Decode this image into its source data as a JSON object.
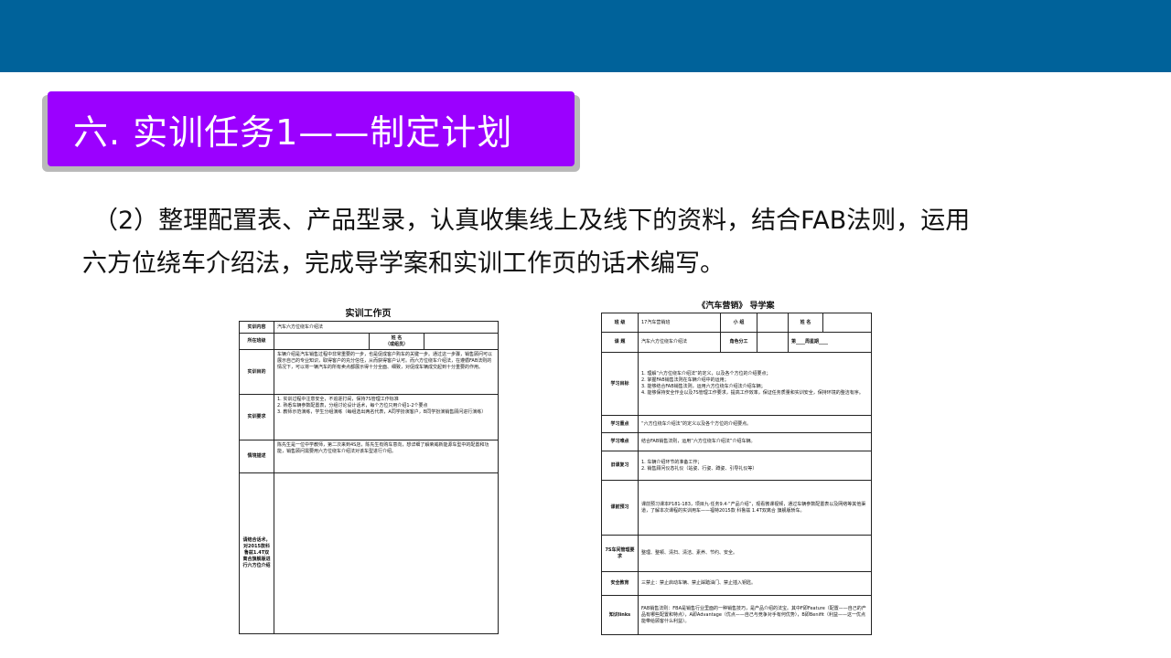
{
  "slide": {
    "title": "六. 实训任务1——制定计划",
    "paragraph_lines": [
      "（2）整理配置表、产品型录，认真收集线上及线下的资料，结合FAB法则，运用",
      "六方位绕车介绍法，完成导学案和实训工作页的话术编写。"
    ]
  },
  "worksheet": {
    "title": "实训工作页",
    "rows": {
      "content_label": "实训内容",
      "content_value": "汽车六方位绕车介绍法",
      "class_label": "所在班级",
      "name_label": "姓  名",
      "name_note": "（或组员）",
      "goal_label": "实训目的",
      "goal_value": "车辆介绍是汽车销售过程中非常重要的一步，也是促成客户购车的关键一步。通过这一步骤，销售顾问可以展示自己的专业知识，取得客户的充分信任，从而获得客户认可。而六方位绕车介绍法，在遵循FAB法则的情况下，可以将一辆汽车的所有卖点都展示得十分全面、细致，对促成车辆成交起到十分重要的作用。",
      "req_label": "实训要求",
      "req_items": [
        "1. 实训过程中注意安全，不追逐打闹，保持7S管理工作标准",
        "2. 熟悉车辆参数配置表，分组讨论设计话术，每个方位只用介绍1-2个要点",
        "3. 教师示范演练，学生分组演练（每组选出两名代表，A同学扮演客户，B同学扮演销售顾问进行演练）"
      ],
      "scene_label": "情境描述",
      "scene_value": "陈先生是一位中学教师，第二次来到4S店，陈先生有购车意向，想详细了解荣威新能源车型中的配置和功能，销售顾问需要用六方位绕车介绍法对该车型进行介绍。",
      "task_label": "请结合话术，对2015款科鲁兹1.4T双离合旗舰版进行六方位介绍"
    }
  },
  "guide": {
    "title": "《汽车营销》  导学案",
    "rows": {
      "class_label": "班 级",
      "class_value": "17汽车营销班",
      "group_label": "小 组",
      "name_label": "姓 名",
      "topic_label": "课 题",
      "topic_value": "汽车六方位绕车介绍法",
      "role_label": "角色分工",
      "week_value": "第____周星期____",
      "goal_label": "学习目标",
      "goal_items": [
        "1. 理解“六方位绕车介绍法”的定义，以及各个方位的介绍要点；",
        "2. 掌握FAB销售法则在车辆介绍中的运用；",
        "3. 能够结合FAB销售法则，运用六方位绕车介绍法介绍车辆；",
        "4. 能够保持安全作业以及7S管理工作要求，提高工作效率，保证任务质量和实训安全，保持环境的整洁有序。"
      ],
      "key_label": "学习重点",
      "key_value": "“六方位绕车介绍法”的定义以及各个方位的介绍要点。",
      "diff_label": "学习难点",
      "diff_value": "结合FAB销售法则，运用“六方位绕车介绍法”介绍车辆。",
      "review_label": "旧课复习",
      "review_items": [
        "1. 车辆介绍环节的准备工作；",
        "2. 销售顾问仪态礼仪（站姿、行姿、蹲姿、引导礼仪等）"
      ],
      "preview_label": "课前预习",
      "preview_value": "课前预习课本P181-183，项目九·任务9.4·“产品介绍”，观看微课视频，通过车辆参数配置表以及网络等其他渠道，了解本次课程的实训用车——福特2015款 科鲁兹 1.4T双离合 旗舰版轿车。",
      "sevens_label": "7S车间管理要求",
      "sevens_value": "整理、整顿、清扫、清洁、素养、节约、安全。",
      "safety_label": "安全教育",
      "safety_value": "三禁止：禁止启动车辆、禁止踩踏油门、禁止插入钥匙。",
      "knowledge_label": "知识links",
      "knowledge_value": "FAB销售法则：FBA是销售行业里面的一种销售技巧，是产品介绍的法宝。其中F即Feature（配置——自己的产品有哪些配置和特点），A即Advantage（优点——自己与竞争对手有何优势），B即Benifit（利益——这一优点能带给顾客什么利益）。"
    }
  }
}
